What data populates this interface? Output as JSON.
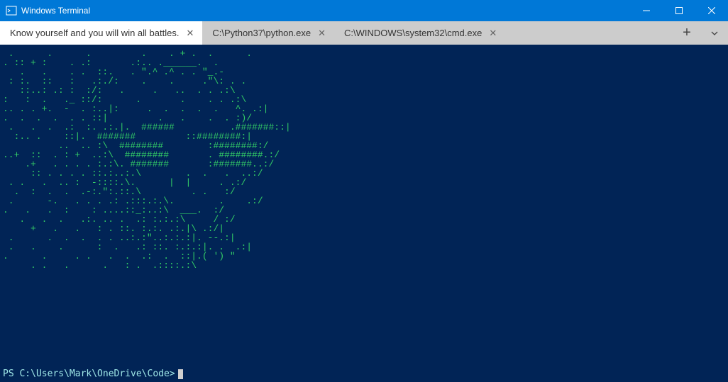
{
  "titlebar": {
    "app_title": "Windows Terminal"
  },
  "tabs": [
    {
      "label": "Know yourself and you will win all battles.",
      "active": true
    },
    {
      "label": "C:\\Python37\\python.exe",
      "active": false
    },
    {
      "label": "C:\\WINDOWS\\system32\\cmd.exe",
      "active": false
    }
  ],
  "terminal": {
    "ascii_art": " .      .      .         .    . + .  .      .\n. :: + :    . .:       .:.. .______.  .\n   .   .    . .  ::.   . \".^ .^ . . \"_.-\n : :.  ::   :   .:./:    .    .     .\"\\: . .\n   ::..: .: :  :/:   .     .   ..  . . .:\\\n:   :  .   ._ ::/:      .       .    . . .:\\\n.. . . +.  -  . :..|:     .  .  .  .  .   ^. .:|\n.  .  .  .  . . ::|         .   .    .  . :)/\n .   .  .  .:  :. .:.|.  ######          .#######::|\n  :.. .    ::|.  #######         ::########:|\n          ..  .. :\\  ########        :########:/\n..+  ::  . : +  ..:\\  ########       . ########.:/\n    .+   . . . . :.:\\. #######       :#######..:/\n     :: . . . . ::.:..:.\\        .  .   .  ..:/\n . .   .  .. :  -::::.\\.      |  |     . .:/\n  .  :  .  .  .-:.\":.::.\\         . .   :/\n .      -.   . . . .: .:::.:.\\.        .    .:/\n.   .   .  :    : ....::_:..:\\  ___.  :/\n   .   .  .   .:. .. .  .: :.:.:\\     / :/\n     +   .   .   : . ::. :.:. .:.|\\ .:/|\n .      .  .  .  . . ..:.:\"..:.:.:|. --.:|\n .   .    .      :  .   .: ::. :.:.:|. .  .:|\n.      .     . .   .  .  .:  .  ::|.( ') \"\n     . .   .      .   : .  .::::.:\\",
    "prompt": "PS C:\\Users\\Mark\\OneDrive\\Code>"
  },
  "colors": {
    "titlebar_bg": "#0078d7",
    "tabbar_bg": "#cccccc",
    "terminal_bg": "#012456",
    "ascii_fg": "#33cc66",
    "prompt_fg": "#9fe7e7"
  }
}
